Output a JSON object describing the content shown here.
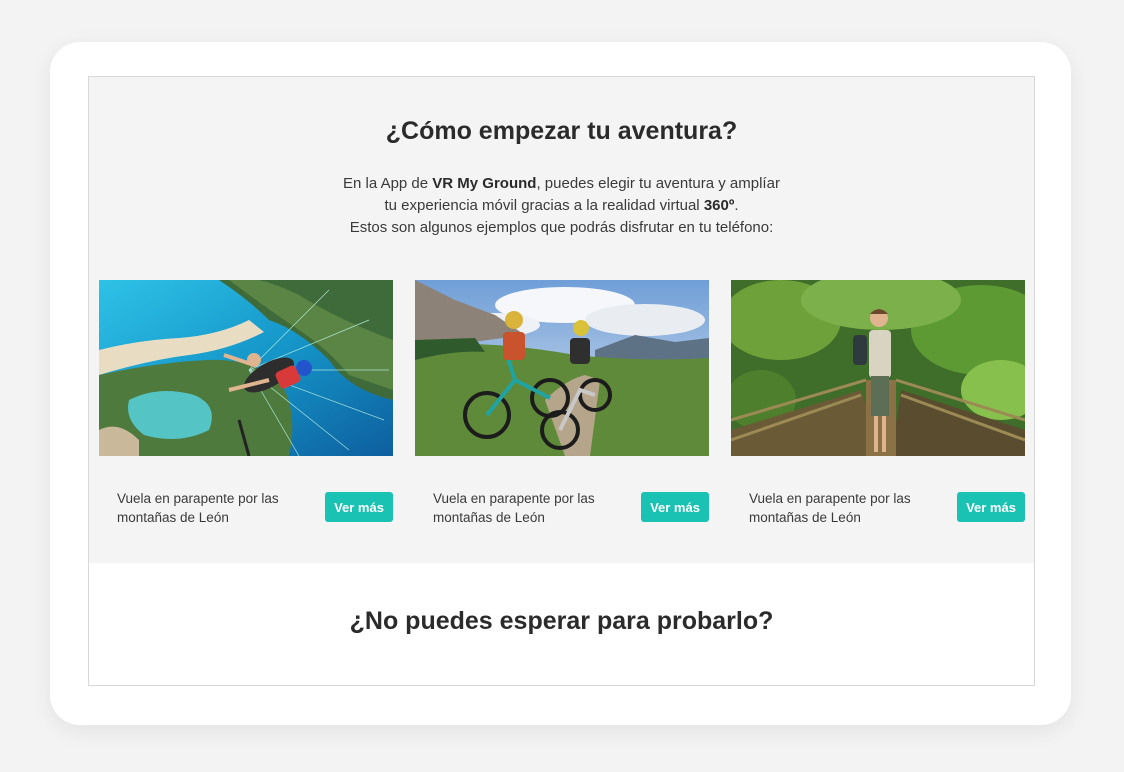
{
  "section": {
    "title": "¿Cómo empezar tu aventura?",
    "intro": {
      "line1_prefix": "En la App de ",
      "line1_brand": "VR My Ground",
      "line1_suffix": ", puedes elegir tu aventura y amplíar",
      "line2_prefix": "tu experiencia móvil gracias a la realidad virtual ",
      "line2_highlight": "360º",
      "line2_suffix": ".",
      "line3": "Estos son algunos ejemplos que podrás disfrutar en tu teléfono:"
    }
  },
  "cards": [
    {
      "caption": "Vuela en parapente por las montañas de León",
      "button": "Ver más",
      "image": "paragliding-photo"
    },
    {
      "caption": "Vuela en parapente por las montañas de León",
      "button": "Ver más",
      "image": "mountain-biking-photo"
    },
    {
      "caption": "Vuela en parapente por las montañas de León",
      "button": "Ver más",
      "image": "jungle-bridge-photo"
    }
  ],
  "cta": {
    "title": "¿No puedes esperar para probarlo?"
  },
  "colors": {
    "accent": "#19c2b3",
    "section_bg": "#f4f4f4",
    "text": "#2b2b2b"
  }
}
